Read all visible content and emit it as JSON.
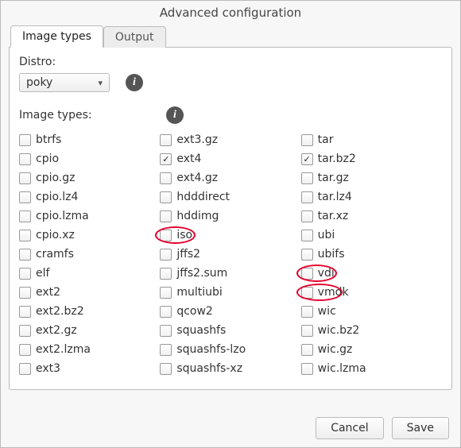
{
  "window": {
    "title": "Advanced configuration"
  },
  "tabs": {
    "image_types": "Image types",
    "output": "Output"
  },
  "distro": {
    "label": "Distro:",
    "value": "poky"
  },
  "image_types_label": "Image types:",
  "info_glyph": "i",
  "columns": {
    "c1": [
      {
        "label": "btrfs",
        "checked": false
      },
      {
        "label": "cpio",
        "checked": false
      },
      {
        "label": "cpio.gz",
        "checked": false
      },
      {
        "label": "cpio.lz4",
        "checked": false
      },
      {
        "label": "cpio.lzma",
        "checked": false
      },
      {
        "label": "cpio.xz",
        "checked": false
      },
      {
        "label": "cramfs",
        "checked": false
      },
      {
        "label": "elf",
        "checked": false
      },
      {
        "label": "ext2",
        "checked": false
      },
      {
        "label": "ext2.bz2",
        "checked": false
      },
      {
        "label": "ext2.gz",
        "checked": false
      },
      {
        "label": "ext2.lzma",
        "checked": false
      },
      {
        "label": "ext3",
        "checked": false
      }
    ],
    "c2": [
      {
        "label": "ext3.gz",
        "checked": false
      },
      {
        "label": "ext4",
        "checked": true
      },
      {
        "label": "ext4.gz",
        "checked": false
      },
      {
        "label": "hdddirect",
        "checked": false
      },
      {
        "label": "hddimg",
        "checked": false
      },
      {
        "label": "iso",
        "checked": false,
        "highlight": true
      },
      {
        "label": "jffs2",
        "checked": false
      },
      {
        "label": "jffs2.sum",
        "checked": false
      },
      {
        "label": "multiubi",
        "checked": false
      },
      {
        "label": "qcow2",
        "checked": false
      },
      {
        "label": "squashfs",
        "checked": false
      },
      {
        "label": "squashfs-lzo",
        "checked": false
      },
      {
        "label": "squashfs-xz",
        "checked": false
      }
    ],
    "c3": [
      {
        "label": "tar",
        "checked": false
      },
      {
        "label": "tar.bz2",
        "checked": true
      },
      {
        "label": "tar.gz",
        "checked": false
      },
      {
        "label": "tar.lz4",
        "checked": false
      },
      {
        "label": "tar.xz",
        "checked": false
      },
      {
        "label": "ubi",
        "checked": false
      },
      {
        "label": "ubifs",
        "checked": false
      },
      {
        "label": "vdi",
        "checked": false,
        "highlight": true
      },
      {
        "label": "vmdk",
        "checked": false,
        "highlight": true
      },
      {
        "label": "wic",
        "checked": false
      },
      {
        "label": "wic.bz2",
        "checked": false
      },
      {
        "label": "wic.gz",
        "checked": false
      },
      {
        "label": "wic.lzma",
        "checked": false
      }
    ]
  },
  "buttons": {
    "cancel": "Cancel",
    "save": "Save"
  }
}
